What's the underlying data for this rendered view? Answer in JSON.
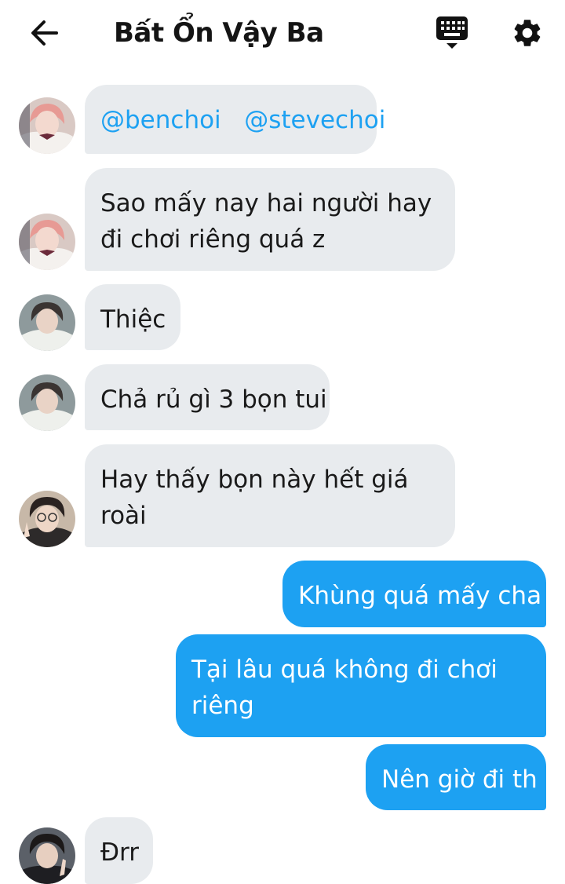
{
  "header": {
    "title": "Bất Ổn Vậy Ba",
    "back_icon": "arrow-left-icon",
    "keyboard_icon": "keyboard-icon",
    "settings_icon": "gear-icon"
  },
  "colors": {
    "incoming_bubble": "#e8ebee",
    "outgoing_bubble": "#1da1f2",
    "mention": "#1da1f2"
  },
  "messages": [
    {
      "direction": "in",
      "sender_avatar": "avatar-pink-hair",
      "mentions": [
        "@benchoi",
        "@stevechoi"
      ]
    },
    {
      "direction": "in",
      "sender_avatar": "avatar-pink-hair",
      "lines": [
        "Sao mấy nay hai người hay",
        "đi chơi riêng quá z"
      ]
    },
    {
      "direction": "in",
      "sender_avatar": "avatar-white-shirt",
      "lines": [
        "Thiệc"
      ]
    },
    {
      "direction": "in",
      "sender_avatar": "avatar-white-shirt",
      "lines": [
        "Chả rủ gì 3 bọn tui"
      ]
    },
    {
      "direction": "in",
      "sender_avatar": "avatar-glasses",
      "lines": [
        "Hay thấy bọn này hết giá",
        "roài"
      ]
    },
    {
      "direction": "out",
      "lines": [
        "Khùng quá mấy cha"
      ]
    },
    {
      "direction": "out",
      "lines": [
        "Tại lâu quá không đi chơi",
        "riêng"
      ]
    },
    {
      "direction": "out",
      "lines": [
        "Nên giờ đi th"
      ]
    },
    {
      "direction": "in",
      "sender_avatar": "avatar-peace-sign",
      "lines": [
        "Đrr"
      ]
    }
  ]
}
